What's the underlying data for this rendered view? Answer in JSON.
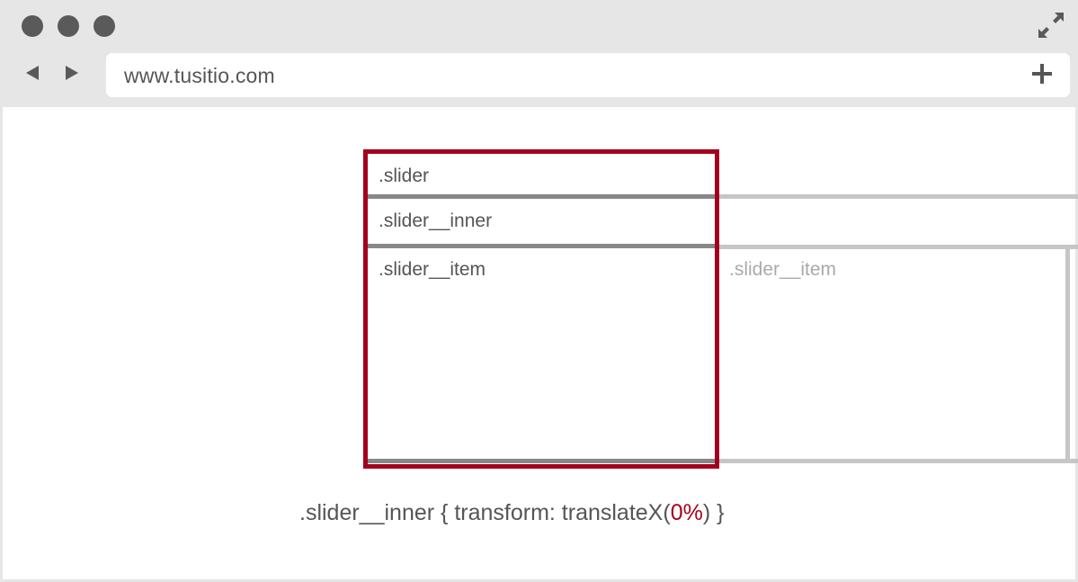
{
  "browser": {
    "url": "www.tusitio.com",
    "window_buttons": [
      "dot",
      "dot",
      "dot"
    ],
    "icons": {
      "expand": "expand-icon",
      "back": "back-arrow-icon",
      "forward": "forward-arrow-icon",
      "new_tab": "plus-icon"
    }
  },
  "diagram": {
    "slider_label": ".slider",
    "inner_label": ".slider__inner",
    "item_label": ".slider__item",
    "ghost_item_label": ".slider__item"
  },
  "code": {
    "prefix": ".slider__inner { transform: translateX(",
    "value": "0%",
    "suffix": ") }"
  },
  "colors": {
    "accent": "#a3001e",
    "chrome": "#e6e6e6",
    "text": "#555555",
    "ghost": "#c6c6c6"
  }
}
